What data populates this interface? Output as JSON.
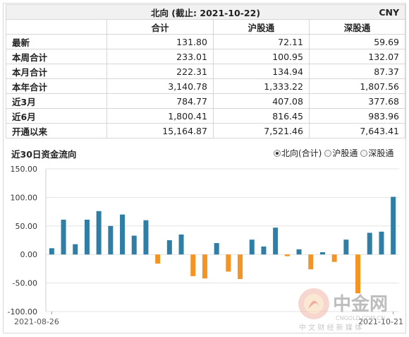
{
  "table": {
    "title": "北向 (截止: 2021-10-22)",
    "currency": "CNY",
    "columns": [
      "合计",
      "沪股通",
      "深股通"
    ],
    "rows": [
      {
        "label": "最新",
        "values": [
          "131.80",
          "72.11",
          "59.69"
        ]
      },
      {
        "label": "本周合计",
        "values": [
          "233.01",
          "100.95",
          "132.07"
        ]
      },
      {
        "label": "本月合计",
        "values": [
          "222.31",
          "134.94",
          "87.37"
        ]
      },
      {
        "label": "本年合计",
        "values": [
          "3,140.78",
          "1,333.22",
          "1,807.56"
        ]
      },
      {
        "label": "近3月",
        "values": [
          "784.77",
          "407.08",
          "377.68"
        ]
      },
      {
        "label": "近6月",
        "values": [
          "1,800.41",
          "816.45",
          "983.96"
        ]
      },
      {
        "label": "开通以来",
        "values": [
          "15,164.87",
          "7,521.46",
          "7,643.41"
        ]
      }
    ]
  },
  "chart_title": "近30日资金流向",
  "series_options": [
    {
      "label": "北向(合计)",
      "selected": true
    },
    {
      "label": "沪股通",
      "selected": false
    },
    {
      "label": "深股通",
      "selected": false
    }
  ],
  "colors": {
    "positive": "#2e7ea6",
    "negative": "#f39423",
    "grid": "#e3e3e3"
  },
  "chart_data": {
    "type": "bar",
    "x_first_label": "2021-08-26",
    "x_last_label": "2021-10-21",
    "values": [
      11,
      61,
      18,
      61,
      76,
      50,
      70,
      33,
      60,
      -16,
      25,
      35,
      -38,
      -42,
      20,
      -30,
      -43,
      26,
      14,
      47,
      -3,
      9,
      -26,
      4,
      -13,
      26,
      -68,
      38,
      40,
      101
    ],
    "ylim": [
      -100,
      150
    ],
    "yticks": [
      "150.00",
      "100.00",
      "50.00",
      "0.00",
      "-50.00",
      "-100.00"
    ],
    "grid": true
  },
  "watermark": {
    "brand": "中金网",
    "domain": "CNGOLD.COM.CN",
    "slogan": "中 文 财 经 新 媒 体"
  }
}
